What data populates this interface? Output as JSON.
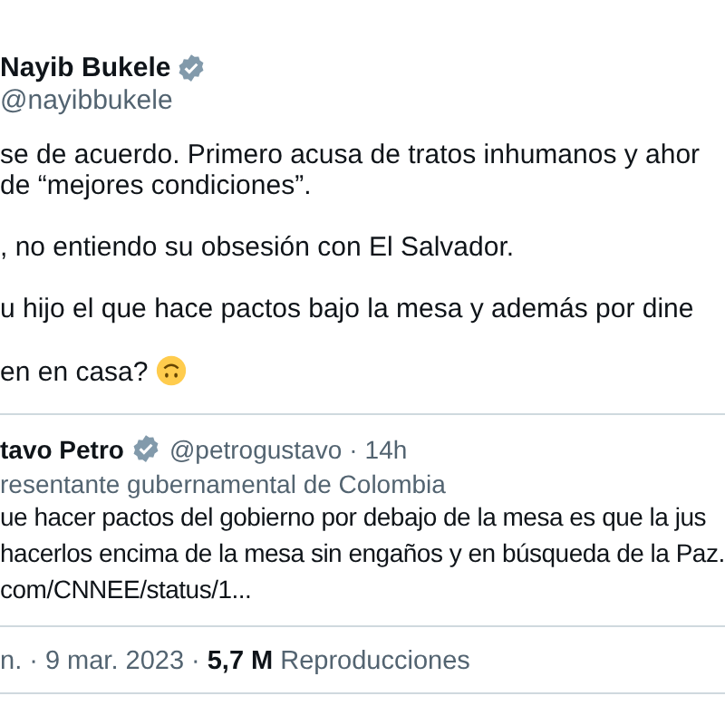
{
  "author": {
    "name": "Nayib Bukele",
    "verified": true,
    "handle": "@nayibbukele"
  },
  "paragraphs": [
    {
      "lines": [
        "se de acuerdo. Primero acusa de tratos inhumanos y ahor",
        "de “mejores condiciones”."
      ]
    },
    {
      "lines": [
        ", no entiendo su obsesión con El Salvador."
      ]
    },
    {
      "lines": [
        "u hijo el que hace pactos bajo la mesa y además por dine"
      ]
    },
    {
      "lines": [
        "en en casa?"
      ],
      "emoji": true
    }
  ],
  "quoted": {
    "name": "tavo Petro",
    "verified": true,
    "handle": "@petrogustavo",
    "separator": "·",
    "time": "14h",
    "label": "resentante gubernamental de Colombia",
    "lines": [
      "ue hacer pactos del gobierno por debajo de la mesa es que la jus",
      "hacerlos encima de la mesa sin engaños y en búsqueda de la Paz.",
      "com/CNNEE/status/1..."
    ]
  },
  "meta": {
    "time": "n.",
    "separator_1": "·",
    "date": "9 mar. 2023",
    "separator_2": "·",
    "views": "5,7 M",
    "views_label": "Reproducciones"
  }
}
